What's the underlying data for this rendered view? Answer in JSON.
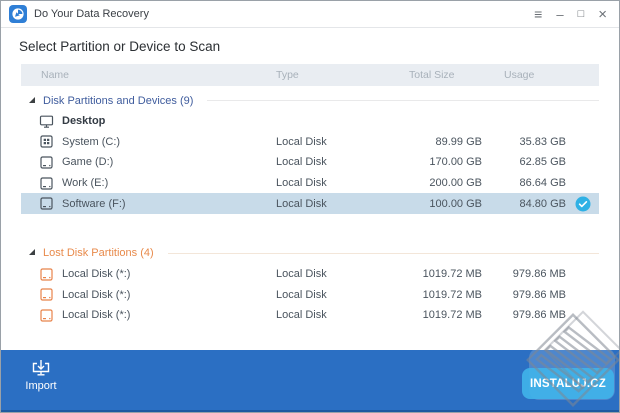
{
  "titlebar": {
    "title": "Do Your Data Recovery",
    "controls": {
      "menu": "≡",
      "minimize": "–",
      "maximize": "□",
      "close": "×"
    }
  },
  "heading": "Select Partition or Device to Scan",
  "table": {
    "columns": [
      "Name",
      "Type",
      "Total Size",
      "Usage"
    ],
    "groups": [
      {
        "label": "Disk Partitions and Devices (9)",
        "label_color": "#3f5c9d",
        "icon_color": "#4a545e",
        "rows": [
          {
            "icon": "monitor",
            "name": "Desktop",
            "bold": true,
            "type": "",
            "total": "",
            "usage": "",
            "selected": false
          },
          {
            "icon": "system-disk",
            "name": "System (C:)",
            "bold": false,
            "type": "Local Disk",
            "total": "89.99 GB",
            "usage": "35.83 GB",
            "selected": false
          },
          {
            "icon": "disk",
            "name": "Game (D:)",
            "bold": false,
            "type": "Local Disk",
            "total": "170.00 GB",
            "usage": "62.85 GB",
            "selected": false
          },
          {
            "icon": "disk",
            "name": "Work (E:)",
            "bold": false,
            "type": "Local Disk",
            "total": "200.00 GB",
            "usage": "86.64 GB",
            "selected": false
          },
          {
            "icon": "disk",
            "name": "Software (F:)",
            "bold": false,
            "type": "Local Disk",
            "total": "100.00 GB",
            "usage": "84.80 GB",
            "selected": true
          }
        ]
      },
      {
        "label": "Lost Disk Partitions (4)",
        "label_color": "#e88a4b",
        "icon_color": "#e8834a",
        "rows": [
          {
            "icon": "disk",
            "name": "Local Disk (*:)",
            "bold": false,
            "type": "Local Disk",
            "total": "1019.72 MB",
            "usage": "979.86 MB",
            "selected": false
          },
          {
            "icon": "disk",
            "name": "Local Disk (*:)",
            "bold": false,
            "type": "Local Disk",
            "total": "1019.72 MB",
            "usage": "979.86 MB",
            "selected": false
          },
          {
            "icon": "disk",
            "name": "Local Disk (*:)",
            "bold": false,
            "type": "Local Disk",
            "total": "1019.72 MB",
            "usage": "979.86 MB",
            "selected": false
          }
        ]
      }
    ]
  },
  "footer": {
    "import_label": "Import"
  },
  "watermark": {
    "badge_label": "INSTALUJ.CZ"
  },
  "colors": {
    "footer_blue": "#2b6fc3",
    "selected_row_bg": "#c8dbe9",
    "check_badge_cyan": "#2fb1e5",
    "group_blue": "#3f5c9d",
    "group_orange": "#e88a4b",
    "badge_cyan": "#41b3e8",
    "header_bg": "#e9edf2"
  }
}
